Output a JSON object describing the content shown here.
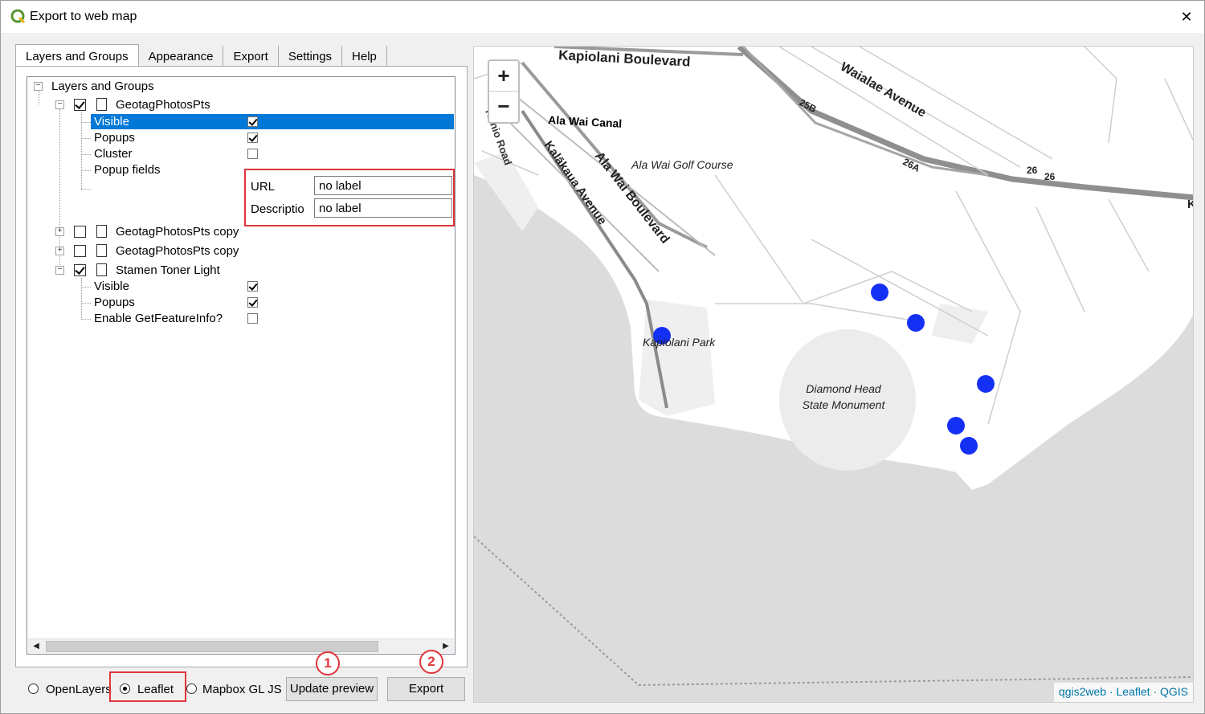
{
  "window": {
    "title": "Export to web map",
    "close_glyph": "✕"
  },
  "tabs": [
    {
      "label": "Layers and Groups",
      "active": true
    },
    {
      "label": "Appearance",
      "active": false
    },
    {
      "label": "Export",
      "active": false
    },
    {
      "label": "Settings",
      "active": false
    },
    {
      "label": "Help",
      "active": false
    }
  ],
  "tree": {
    "root_label": "Layers and Groups",
    "layer1": {
      "name": "GeotagPhotosPts",
      "checked": true,
      "visible_label": "Visible",
      "popups_label": "Popups",
      "cluster_label": "Cluster",
      "popup_fields_label": "Popup fields",
      "fields": [
        {
          "name": "URL",
          "value": "no label"
        },
        {
          "name": "Descriptio",
          "value": "no label"
        }
      ]
    },
    "layer2": {
      "name": "GeotagPhotosPts copy",
      "checked": false
    },
    "layer3": {
      "name": "GeotagPhotosPts copy",
      "checked": false
    },
    "layer4": {
      "name": "Stamen Toner Light",
      "checked": true,
      "visible_label": "Visible",
      "popups_label": "Popups",
      "getfeatureinfo_label": "Enable GetFeatureInfo?"
    }
  },
  "bottom": {
    "radio_openlayers": "OpenLayers",
    "radio_leaflet": "Leaflet",
    "radio_mapbox": "Mapbox GL JS",
    "selected": "Leaflet",
    "update_preview": "Update preview",
    "export": "Export",
    "badge1": "1",
    "badge2": "2"
  },
  "map": {
    "zoom_in": "+",
    "zoom_out": "−",
    "labels": {
      "kapiolani_blvd": "Kapiolani Boulevard",
      "waialae_ave": "Waialae Avenue",
      "ala_wai_canal": "Ala Wai Canal",
      "ala_wai_golf": "Ala Wai Golf Course",
      "ala_wai_blvd": "Ala Wai Boulevard",
      "kalakaua_ave": "Kalākaua Avenue",
      "kuhio_road": "Kuhio Road",
      "kapiolani_park": "Kapiolani Park",
      "diamond_head_1": "Diamond Head",
      "diamond_head_2": "State Monument",
      "exit_25b": "25B",
      "exit_26a": "26A",
      "exit_26_1": "26",
      "exit_26_2": "26",
      "edge_k": "K"
    },
    "attribution": "qgis2web · Leaflet · QGIS",
    "point_color": "#1530f5"
  }
}
